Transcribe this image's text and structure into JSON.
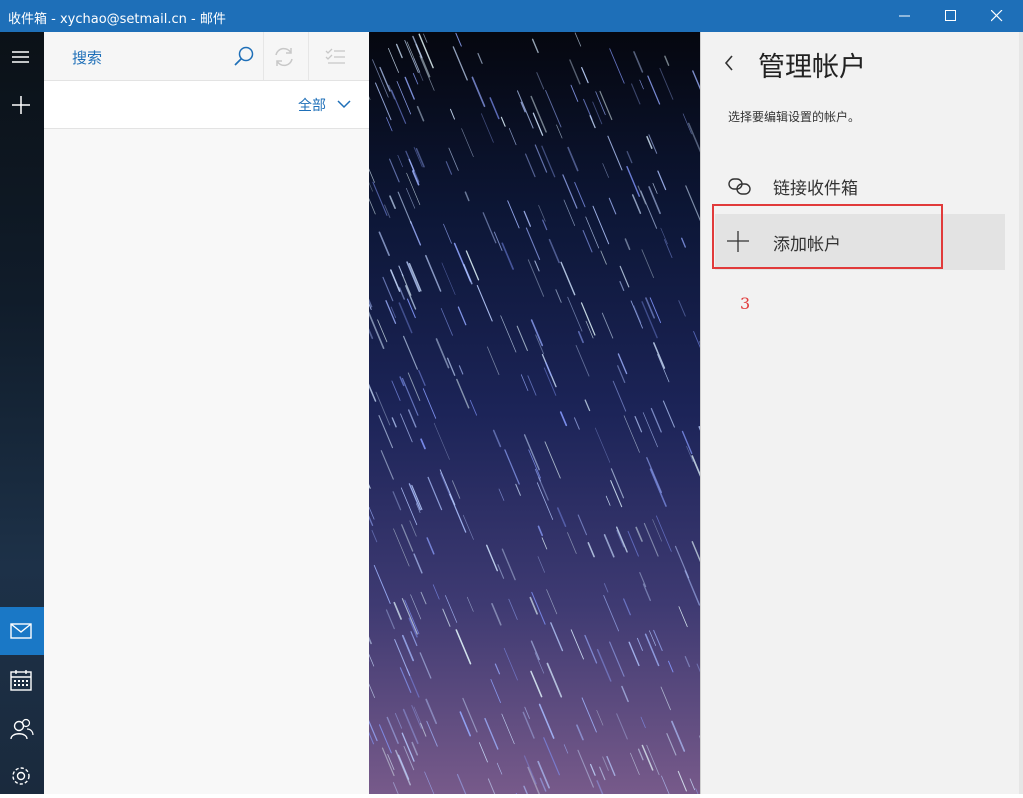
{
  "window": {
    "title": "收件箱 - xychao@setmail.cn - 邮件",
    "controls": [
      "minimize-icon",
      "maximize-icon",
      "close-icon"
    ],
    "titlebar_color": "#1e6fb8"
  },
  "nav_rail": {
    "items": [
      {
        "name": "hamburger-menu",
        "icon": "hamburger-icon"
      },
      {
        "name": "new-mail",
        "icon": "plus-icon"
      },
      {
        "name": "mail",
        "icon": "mail-icon",
        "active": true
      },
      {
        "name": "calendar",
        "icon": "calendar-icon"
      },
      {
        "name": "people",
        "icon": "people-icon"
      },
      {
        "name": "settings",
        "icon": "gear-icon"
      }
    ],
    "accent_color": "#1a78c6"
  },
  "message_list": {
    "search_label": "搜索",
    "filter_label": "全部",
    "toolbar_icons": [
      "search-icon",
      "sync-icon",
      "select-mode-icon"
    ]
  },
  "manage_accounts": {
    "title": "管理帐户",
    "description": "选择要编辑设置的帐户。",
    "items": [
      {
        "label": "链接收件箱",
        "icon": "link-icon"
      },
      {
        "label": "添加帐户",
        "icon": "plus-icon"
      }
    ],
    "annotation_step": "3",
    "annotation_color": "#e13a3a"
  }
}
